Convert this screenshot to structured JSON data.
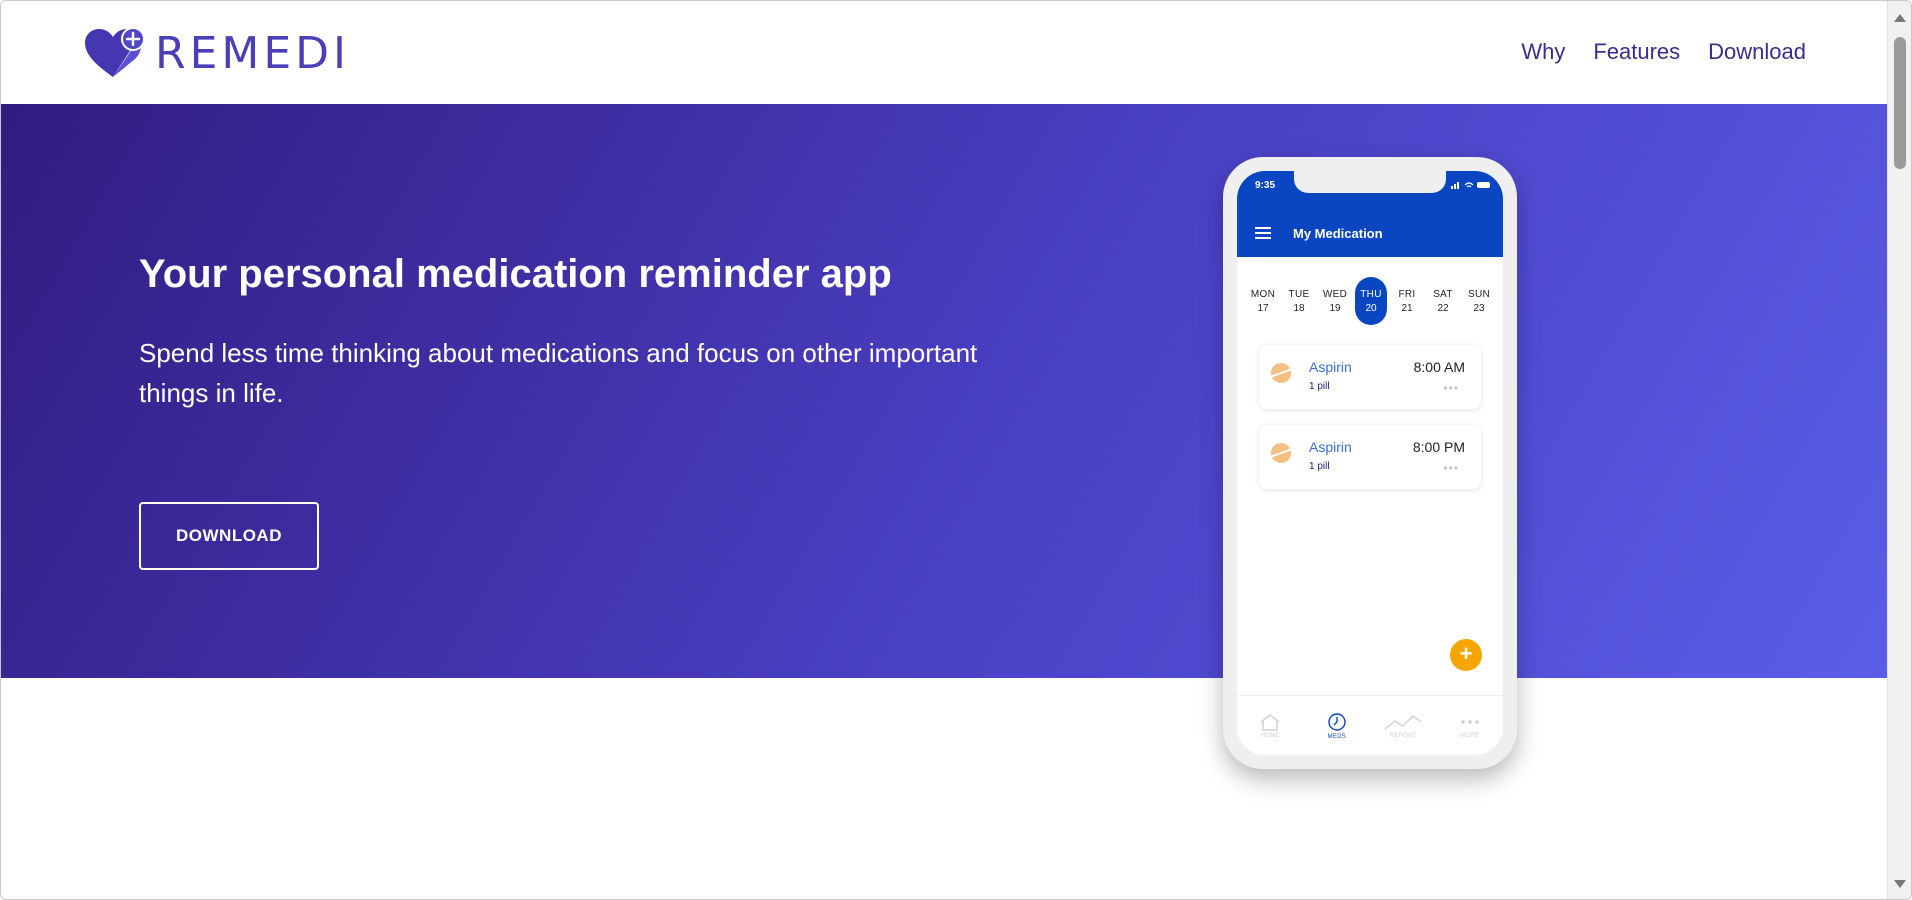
{
  "brand": {
    "name": "REMEDI",
    "logo_icon": "heart-plus-icon",
    "color": "#4a3fb8"
  },
  "nav": {
    "items": [
      "Why",
      "Features",
      "Download"
    ]
  },
  "hero": {
    "title": "Your personal medication reminder app",
    "subtitle": "Spend less time thinking about medications and focus on other important things in life.",
    "cta": "DOWNLOAD",
    "gradient": [
      "#321c80",
      "#4a40c4",
      "#5a5de6"
    ]
  },
  "phone": {
    "time": "9:35",
    "title": "My Medication",
    "days": [
      {
        "name": "MON",
        "date": "17"
      },
      {
        "name": "TUE",
        "date": "18"
      },
      {
        "name": "WED",
        "date": "19"
      },
      {
        "name": "THU",
        "date": "20",
        "active": true
      },
      {
        "name": "FRI",
        "date": "21"
      },
      {
        "name": "SAT",
        "date": "22"
      },
      {
        "name": "SUN",
        "date": "23"
      }
    ],
    "meds": [
      {
        "name": "Aspirin",
        "qty": "1 pill",
        "time": "8:00 AM",
        "more": "•••"
      },
      {
        "name": "Aspirin",
        "qty": "1 pill",
        "time": "8:00 PM",
        "more": "•••"
      }
    ],
    "fab": "+",
    "tabs": [
      {
        "label": "HOME",
        "icon": "home-icon"
      },
      {
        "label": "MEDS",
        "icon": "clock-icon",
        "active": true
      },
      {
        "label": "REPORT",
        "icon": "chart-line-icon"
      },
      {
        "label": "MORE",
        "icon": "more-icon"
      }
    ],
    "accent": "#0b46c2",
    "fab_color": "#f6a600"
  }
}
